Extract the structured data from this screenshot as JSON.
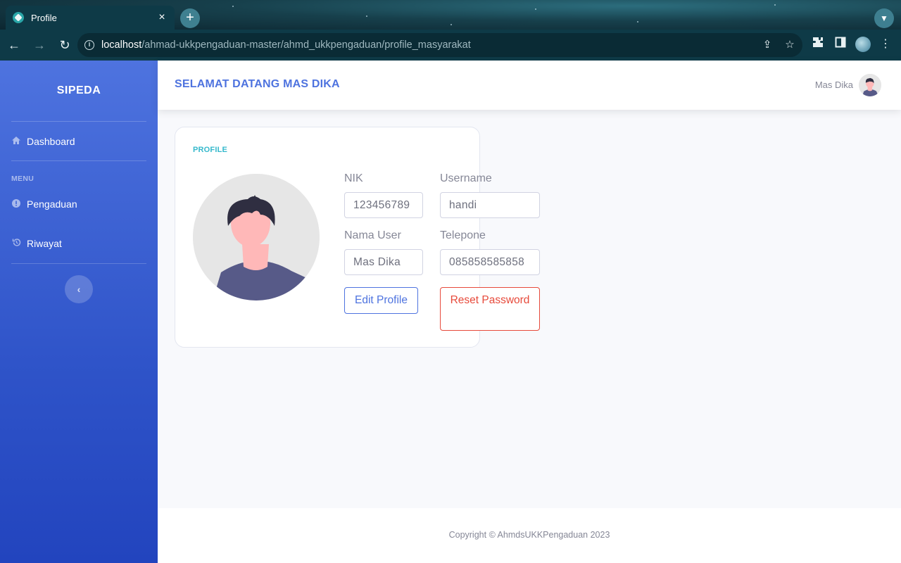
{
  "browser": {
    "tab_title": "Profile",
    "tab_close": "×",
    "new_tab": "+",
    "url_host": "localhost",
    "url_path": "/ahmad-ukkpengaduan-master/ahmd_ukkpengaduan/profile_masyarakat"
  },
  "sidebar": {
    "brand": "SIPEDA",
    "dashboard_label": "Dashboard",
    "menu_heading": "MENU",
    "items": [
      {
        "label": "Pengaduan",
        "icon": "info-circle-icon"
      },
      {
        "label": "Riwayat",
        "icon": "history-icon"
      }
    ],
    "toggle_icon": "chevron-left-icon"
  },
  "topbar": {
    "welcome": "SELAMAT DATANG MAS DIKA",
    "user_name": "Mas Dika"
  },
  "profile_card": {
    "title": "PROFILE",
    "nik_label": "NIK",
    "nik_value": "123456789",
    "username_label": "Username",
    "username_value": "handi",
    "nama_label": "Nama User",
    "nama_value": "Mas Dika",
    "telepone_label": "Telepone",
    "telepone_value": "085858585858",
    "edit_button": "Edit Profile",
    "reset_button": "Reset Password"
  },
  "footer": {
    "copyright": "Copyright © AhmdsUKKPengaduan 2023"
  },
  "colors": {
    "primary": "#4e73df",
    "info": "#36b9cc",
    "danger": "#e74a3b",
    "text_muted": "#858796"
  }
}
